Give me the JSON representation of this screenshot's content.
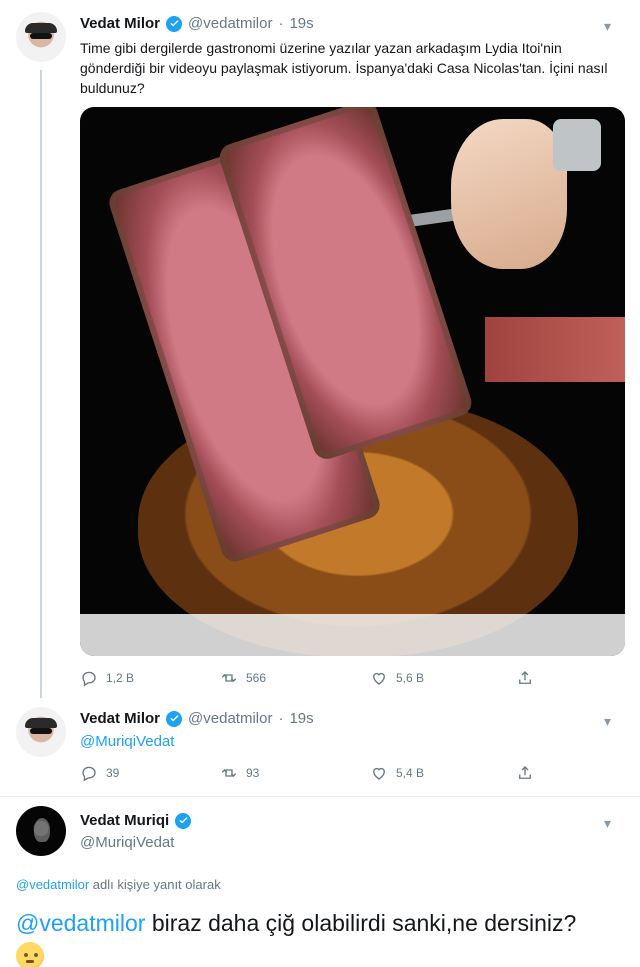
{
  "tweet1": {
    "display_name": "Vedat Milor",
    "handle": "@vedatmilor",
    "separator": "·",
    "time": "19s",
    "text": "Time gibi dergilerde gastronomi üzerine yazılar yazan arkadaşım Lydia Itoi'nin gönderdiği bir videoyu paylaşmak istiyorum. İspanya'daki Casa Nicolas'tan. İçini nasıl buldunuz?",
    "stats": {
      "replies": "1,2 B",
      "retweets": "566",
      "likes": "5,6 B"
    }
  },
  "tweet2": {
    "display_name": "Vedat Milor",
    "handle": "@vedatmilor",
    "separator": "·",
    "time": "19s",
    "text": "@MuriqiVedat",
    "stats": {
      "replies": "39",
      "retweets": "93",
      "likes": "5,4 B"
    }
  },
  "tweet3": {
    "display_name": "Vedat Muriqi",
    "handle": "@MuriqiVedat",
    "context_mention": "@vedatmilor",
    "context_text": "adlı kişiye yanıt olarak",
    "reply_mention": "@vedatmilor",
    "reply_text": "biraz daha çiğ olabilirdi sanki,ne dersiniz?"
  },
  "icons": [
    "reply-icon",
    "retweet-icon",
    "like-icon",
    "share-icon",
    "verified-icon",
    "chevron-down-icon"
  ],
  "colors": {
    "accent": "#1da1f2",
    "secondary_text": "#657786",
    "primary_text": "#14171a"
  }
}
